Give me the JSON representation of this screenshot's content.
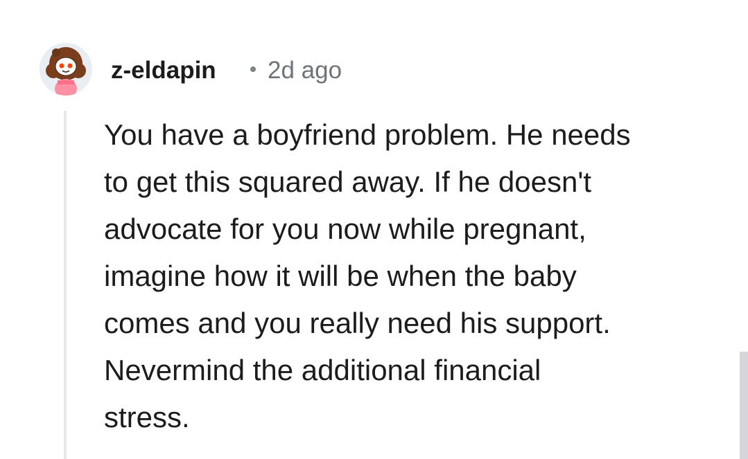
{
  "comment": {
    "author": "z-eldapin",
    "separator": "•",
    "timestamp": "2d ago",
    "avatar_icon": "reddit-snoo-avatar-icon",
    "body_lines": [
      "You have a boyfriend problem. He needs",
      "to get this squared away. If he doesn't",
      "advocate for you now while pregnant,",
      "imagine how it will be when the baby",
      "comes and you really need his support.",
      "Nevermind the additional financial",
      "stress."
    ]
  },
  "colors": {
    "text": "#1c1c1c",
    "meta": "#6d7378",
    "thread_line": "#e6e8ea",
    "scrollbar": "#d4d6d9"
  }
}
